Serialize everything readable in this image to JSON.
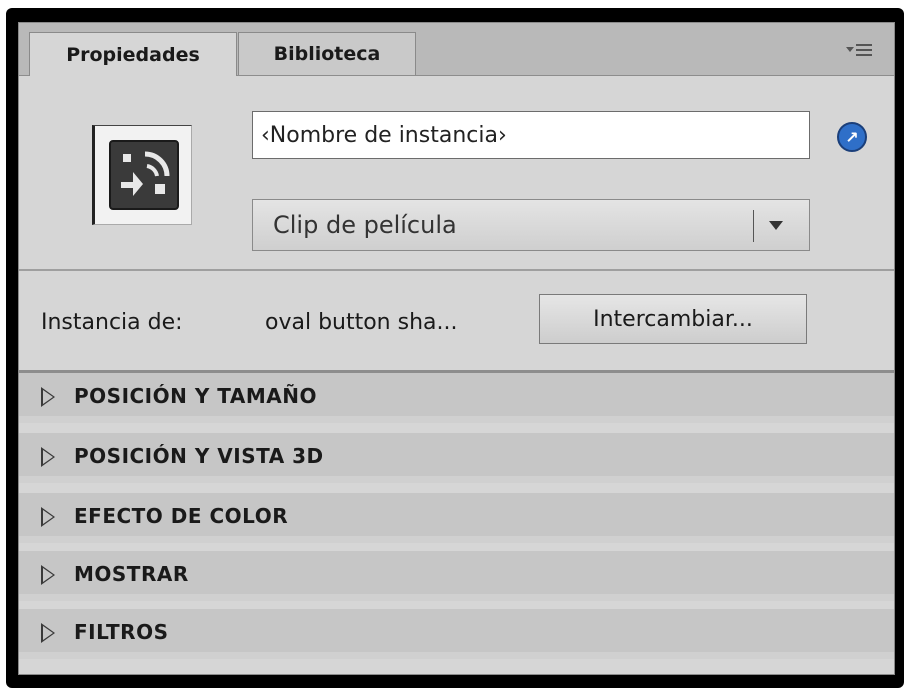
{
  "tabs": [
    {
      "label": "Propiedades",
      "active": true
    },
    {
      "label": "Biblioteca",
      "active": false
    }
  ],
  "icons": {
    "panel_menu": "panel-menu-icon",
    "symbol": "movie-clip-symbol-icon",
    "help": "help-arrow-icon",
    "dropdown": "chevron-down-icon",
    "section_toggle": "disclosure-triangle-icon"
  },
  "instance": {
    "name_value": "‹Nombre de instancia›",
    "type_value": "Clip de película",
    "instance_of_label": "Instancia de:",
    "instance_of_value": "oval button sha...",
    "swap_label": "Intercambiar..."
  },
  "sections": [
    {
      "label": "POSICIÓN Y TAMAÑO"
    },
    {
      "label": "POSICIÓN Y VISTA 3D"
    },
    {
      "label": "EFECTO DE COLOR"
    },
    {
      "label": "MOSTRAR"
    },
    {
      "label": "FILTROS"
    }
  ],
  "colors": {
    "panel_bg": "#d6d6d6",
    "tabbar_bg": "#b9b9b9",
    "section_bg": "#c6c6c6",
    "help_icon": "#2f6fc8"
  }
}
